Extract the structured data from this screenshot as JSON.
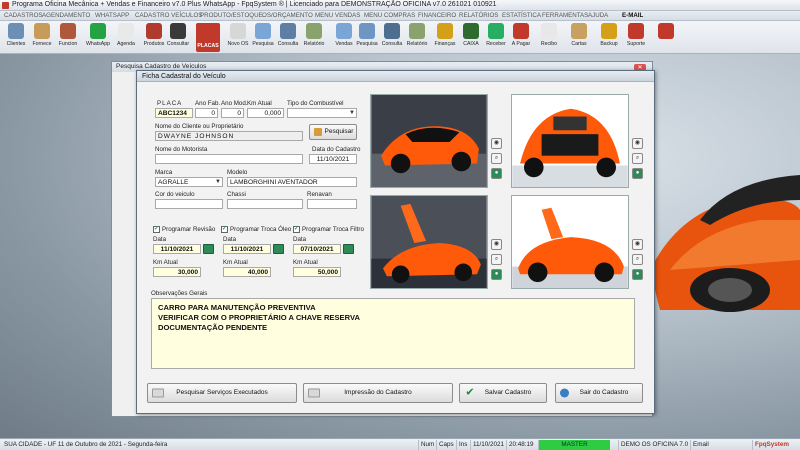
{
  "window": {
    "title": "Programa Oficina Mecânica + Vendas e Financeiro v7.0 Plus WhatsApp - FpqSystem ® | Licenciado para  DEMONSTRAÇÃO OFICINA v7.0 261021 010921"
  },
  "menu": [
    "CADASTROS",
    "AGENDAMENTO",
    "WHATSAPP",
    "CADASTRO VEÍCULOS",
    "PRODUTO/ESTOQUE",
    "OS/ORÇAMENTO",
    "MENU VENDAS",
    "MENU COMPRAS",
    "FINANCEIRO",
    "RELATÓRIOS",
    "ESTATÍSTICA",
    "FERRAMENTAS",
    "AJUDA",
    "E-MAIL"
  ],
  "toolbar": {
    "items": [
      {
        "label": "Clientes",
        "icon": "clients-icon",
        "color": "#6b8fb5"
      },
      {
        "label": "Fornece",
        "icon": "supplier-icon",
        "color": "#c79b5a"
      },
      {
        "label": "Funcion",
        "icon": "employee-icon",
        "color": "#b0583b"
      },
      {
        "label": "WhatsApp",
        "icon": "whatsapp-icon",
        "color": "#25a244"
      },
      {
        "label": "Agenda",
        "icon": "calendar-icon",
        "color": "#e9e9e9"
      },
      {
        "label": "Produtos",
        "icon": "products-icon",
        "color": "#b03a2e"
      },
      {
        "label": "Consultar",
        "icon": "search-products-icon",
        "color": "#3a3a3a"
      },
      {
        "label": "PLACAS",
        "icon": "plates-icon",
        "color": "#c0392b"
      },
      {
        "label": "Novo OS",
        "icon": "new-os-icon",
        "color": "#d7d7d7"
      },
      {
        "label": "Pesquisa",
        "icon": "search-os-icon",
        "color": "#7aa6d6"
      },
      {
        "label": "Consulta",
        "icon": "consult-os-icon",
        "color": "#5c7fa3"
      },
      {
        "label": "Relatório",
        "icon": "report-os-icon",
        "color": "#8aa36c"
      },
      {
        "label": "Vendas",
        "icon": "sales-icon",
        "color": "#7aa6d6"
      },
      {
        "label": "Pesquisa",
        "icon": "search-sales-icon",
        "color": "#6f95c2"
      },
      {
        "label": "Consulta",
        "icon": "consult-sales-icon",
        "color": "#4d6e91"
      },
      {
        "label": "Relatório",
        "icon": "report-sales-icon",
        "color": "#8aa36c"
      },
      {
        "label": "Finanças",
        "icon": "finance-icon",
        "color": "#d4a017"
      },
      {
        "label": "CAIXA",
        "icon": "cashier-icon",
        "color": "#2f6b2f"
      },
      {
        "label": "Receber",
        "icon": "receive-icon",
        "color": "#27ae60"
      },
      {
        "label": "A Pagar",
        "icon": "pay-icon",
        "color": "#c0392b"
      },
      {
        "label": "Recibo",
        "icon": "receipt-icon",
        "color": "#e8e8e8"
      },
      {
        "label": "Cartas",
        "icon": "letters-icon",
        "color": "#c8a060"
      },
      {
        "label": "Backup",
        "icon": "backup-icon",
        "color": "#d4a017"
      },
      {
        "label": "Suporte",
        "icon": "support-icon",
        "color": "#c0392b"
      },
      {
        "label": "",
        "icon": "exit-icon",
        "color": "#c0392b"
      }
    ]
  },
  "back_window": {
    "title": "Pesquisa Cadastro de Veículos"
  },
  "dialog": {
    "title": "Ficha Cadastral do Veículo",
    "placa_label": "PLACA",
    "placa_value": "ABC1234",
    "ano_fab_label": "Ano Fab.",
    "ano_fab_value": "0",
    "ano_mod_label": "Ano Mod.",
    "ano_mod_value": "0",
    "km_label": "Km Atual",
    "km_value": "0,000",
    "combustivel_label": "Tipo do Combustível",
    "combustivel_value": "",
    "cliente_label": "Nome do Cliente ou Proprietário",
    "cliente_value": "DWAYNE JOHNSON",
    "pesquisar_label": "Pesquisar",
    "motorista_label": "Nome do Motorista",
    "motorista_value": "",
    "data_cadastro_label": "Data do Cadastro",
    "data_cadastro_value": "11/10/2021",
    "marca_label": "Marca",
    "marca_value": "AGRALLE",
    "modelo_label": "Modelo",
    "modelo_value": "LAMBORGHINI AVENTADOR",
    "cor_label": "Cor do veiculo",
    "cor_value": "",
    "chassi_label": "Chassi",
    "chassi_value": "",
    "renavan_label": "Renavan",
    "renavan_value": "",
    "revisao": {
      "check_label": "Programar Revisão",
      "data_label": "Data",
      "data_value": "11/10/2021",
      "km_label": "Km Atual",
      "km_value": "30,000"
    },
    "oleo": {
      "check_label": "Programar Troca Óleo",
      "data_label": "Data",
      "data_value": "11/10/2021",
      "km_label": "Km Atual",
      "km_value": "40,000"
    },
    "filtro": {
      "check_label": "Programar Troca Filtro",
      "data_label": "Data",
      "data_value": "07/10/2021",
      "km_label": "Km Atual",
      "km_value": "50,000"
    },
    "obs_label": "Observações Gerais",
    "obs_lines": [
      "CARRO PARA MANUTENÇÃO PREVENTIVA",
      "VERIFICAR COM O PROPRIETÁRIO A CHAVE RESERVA",
      "DOCUMENTAÇÃO PENDENTE"
    ],
    "buttons": {
      "servicos": "Pesquisar Serviços Executados",
      "impressao": "Impressão do Cadastro",
      "salvar": "Salvar Cadastro",
      "sair": "Sair do Cadastro"
    }
  },
  "statusbar": {
    "cidade": "SUA CIDADE - UF 11 de Outubro de 2021 - Segunda-feira",
    "num": "Num",
    "caps": "Caps",
    "ins": "Ins",
    "date": "11/10/2021",
    "time": "20:48:19",
    "master": "MASTER",
    "demo": "DEMO OS OFICINA 7.0",
    "email": "Email",
    "brand": "FpqSystem"
  }
}
